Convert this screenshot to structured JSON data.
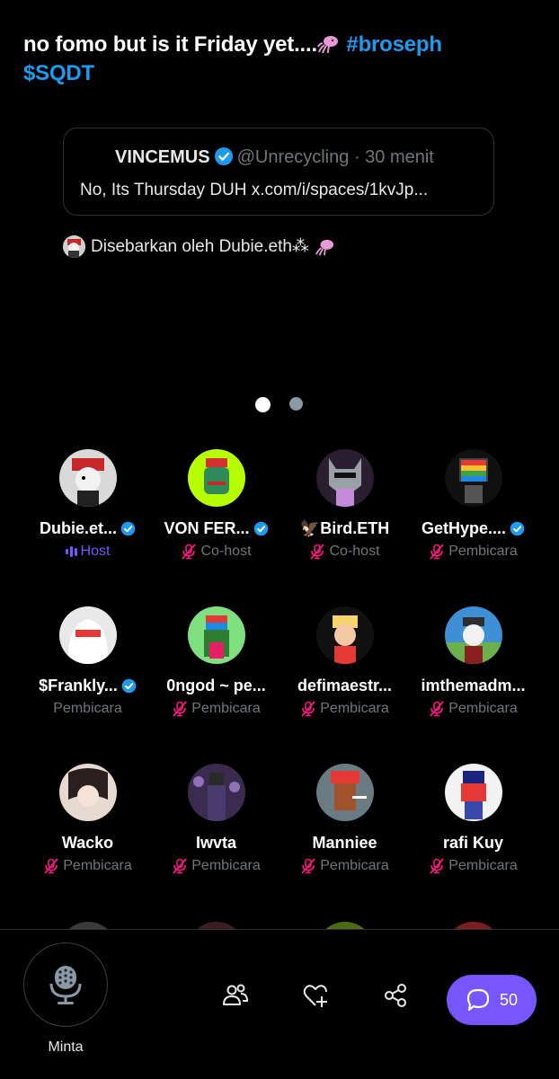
{
  "post": {
    "text_main": "no fomo but is it Friday yet....",
    "hashtag": "#broseph",
    "cashtag": "$SQDT"
  },
  "quote": {
    "name": "VINCEMUS",
    "handle": "@Unrecycling",
    "time": "· 30 menit",
    "body": "No, Its Thursday DUH x.com/i/spaces/1kvJp..."
  },
  "repost": {
    "label": "Disebarkan oleh Dubie.eth⁂"
  },
  "pager": {
    "count": 2,
    "active": 0
  },
  "participants": [
    {
      "name": "Dubie.et...",
      "verified": true,
      "role": "Host",
      "role_icon": "speaking-wave-icon"
    },
    {
      "name": "VON FER...",
      "verified": true,
      "role": "Co-host",
      "role_icon": "mic-muted-icon"
    },
    {
      "name": "🦅Bird.ETH",
      "verified": false,
      "role": "Co-host",
      "role_icon": "mic-muted-icon"
    },
    {
      "name": "GetHype....",
      "verified": true,
      "role": "Pembicara",
      "role_icon": "mic-muted-icon"
    },
    {
      "name": "$Frankly...",
      "verified": true,
      "role": "Pembicara",
      "role_icon": "none"
    },
    {
      "name": "0ngod ~ pe...",
      "verified": false,
      "role": "Pembicara",
      "role_icon": "mic-muted-icon"
    },
    {
      "name": "defimaestr...",
      "verified": false,
      "role": "Pembicara",
      "role_icon": "mic-muted-icon"
    },
    {
      "name": "imthemadm...",
      "verified": false,
      "role": "Pembicara",
      "role_icon": "mic-muted-icon"
    },
    {
      "name": "Wacko",
      "verified": false,
      "role": "Pembicara",
      "role_icon": "mic-muted-icon"
    },
    {
      "name": "Iwvta",
      "verified": false,
      "role": "Pembicara",
      "role_icon": "mic-muted-icon"
    },
    {
      "name": "Manniee",
      "verified": false,
      "role": "Pembicara",
      "role_icon": "mic-muted-icon"
    },
    {
      "name": "rafi Kuy",
      "verified": false,
      "role": "Pembicara",
      "role_icon": "mic-muted-icon"
    }
  ],
  "bottom": {
    "mic_label": "Minta",
    "chat_count": "50"
  },
  "colors": {
    "accent_blue": "#1d9bf0",
    "muted_pink": "#f91880",
    "host_purple": "#7856ff",
    "secondary_text": "#71767b"
  }
}
